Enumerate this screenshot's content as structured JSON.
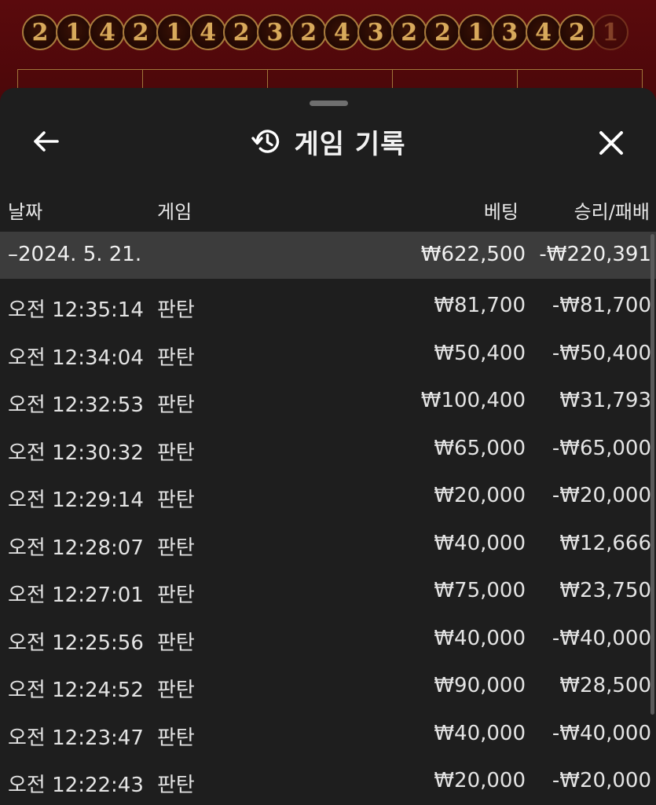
{
  "road": {
    "results": [
      "2",
      "1",
      "4",
      "2",
      "1",
      "4",
      "2",
      "3",
      "2",
      "4",
      "3",
      "2",
      "2",
      "1",
      "3",
      "4",
      "2",
      "1"
    ]
  },
  "sheet": {
    "title": "게임 기록",
    "icons": {
      "back": "arrow-left-icon",
      "history": "history-icon",
      "close": "close-icon"
    }
  },
  "columns": {
    "date": "날짜",
    "game": "게임",
    "bet": "베팅",
    "result": "승리/패배"
  },
  "group": {
    "date": "–2024. 5. 21.",
    "bet": "₩622,500",
    "result": "-₩220,391"
  },
  "rows": [
    {
      "time": "오전 12:35:14",
      "game": "판탄",
      "bet": "₩81,700",
      "result": "-₩81,700"
    },
    {
      "time": "오전 12:34:04",
      "game": "판탄",
      "bet": "₩50,400",
      "result": "-₩50,400"
    },
    {
      "time": "오전 12:32:53",
      "game": "판탄",
      "bet": "₩100,400",
      "result": "₩31,793"
    },
    {
      "time": "오전 12:30:32",
      "game": "판탄",
      "bet": "₩65,000",
      "result": "-₩65,000"
    },
    {
      "time": "오전 12:29:14",
      "game": "판탄",
      "bet": "₩20,000",
      "result": "-₩20,000"
    },
    {
      "time": "오전 12:28:07",
      "game": "판탄",
      "bet": "₩40,000",
      "result": "₩12,666"
    },
    {
      "time": "오전 12:27:01",
      "game": "판탄",
      "bet": "₩75,000",
      "result": "₩23,750"
    },
    {
      "time": "오전 12:25:56",
      "game": "판탄",
      "bet": "₩40,000",
      "result": "-₩40,000"
    },
    {
      "time": "오전 12:24:52",
      "game": "판탄",
      "bet": "₩90,000",
      "result": "₩28,500"
    },
    {
      "time": "오전 12:23:47",
      "game": "판탄",
      "bet": "₩40,000",
      "result": "-₩40,000"
    },
    {
      "time": "오전 12:22:43",
      "game": "판탄",
      "bet": "₩20,000",
      "result": "-₩20,000"
    }
  ]
}
